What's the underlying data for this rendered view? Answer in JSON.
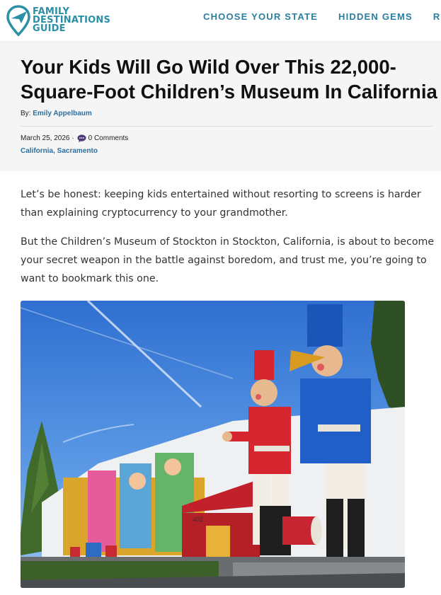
{
  "logo": {
    "line1": "FAMILY",
    "line2": "DESTINATIONS",
    "line3": "GUIDE"
  },
  "nav": {
    "item1": "CHOOSE YOUR STATE",
    "item2": "HIDDEN GEMS",
    "item3": "RES"
  },
  "article": {
    "title": "Your Kids Will Go Wild Over This 22,000-Square-Foot Children’s Museum In California",
    "by_label": "By:",
    "author": "Emily Appelbaum",
    "date": "March 25, 2026 ·",
    "comments": "0 Comments",
    "categories": "California, Sacramento",
    "paragraph1": "Let’s be honest: keeping kids entertained without resorting to screens is harder than explaining cryptocurrency to your grandmother.",
    "paragraph2": "But the Children’s Museum of Stockton in Stockton, California, is about to become your secret weapon in the battle against boredom, and trust me, you’re going to want to bookmark this one.",
    "building_number": "402"
  },
  "colors": {
    "brand": "#2b8fa5",
    "link": "#2b6fa0",
    "hero_bg": "#f5f5f5"
  }
}
